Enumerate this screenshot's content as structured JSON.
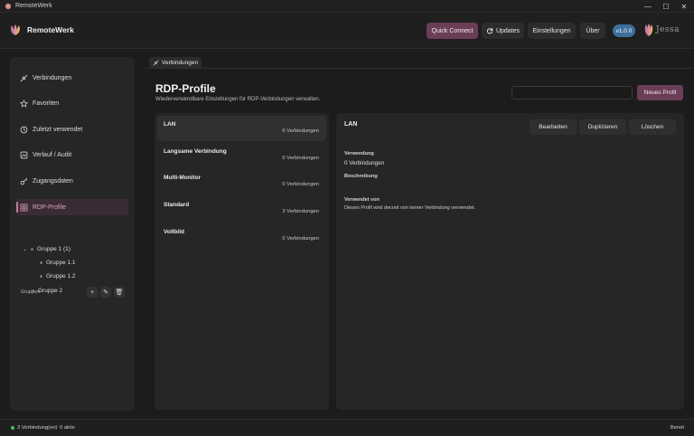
{
  "window": {
    "title": "RemoteWerk",
    "controls": {
      "minimize": "—",
      "maximize": "☐",
      "close": "✕"
    }
  },
  "header": {
    "brand": "RemoteWerk",
    "quick_connect": "Quick Connect",
    "updates": "Updates",
    "settings": "Einstellungen",
    "about": "Über",
    "version": "v1.0.0",
    "partner_logo_text": "Jessa",
    "accent": "#6a3e56"
  },
  "sidebar": {
    "items": [
      {
        "label": "Verbindungen",
        "icon": "plug-icon"
      },
      {
        "label": "Favoriten",
        "icon": "star-icon"
      },
      {
        "label": "Zuletzt verwendet",
        "icon": "history-icon"
      },
      {
        "label": "Verlauf / Audit",
        "icon": "audit-icon"
      },
      {
        "label": "Zugangsdaten",
        "icon": "key-icon"
      },
      {
        "label": "RDP-Profile",
        "icon": "profiles-icon",
        "active": true
      }
    ],
    "groups_label": "Gruppen",
    "group_actions": {
      "add": "+",
      "edit": "✎",
      "delete": "🗑"
    },
    "groups": [
      {
        "label": "Gruppe 1 (1)",
        "expanded": true,
        "children": [
          {
            "label": "Gruppe 1.1"
          },
          {
            "label": "Gruppe 1.2"
          }
        ]
      },
      {
        "label": "Gruppe 2"
      }
    ]
  },
  "tab": {
    "label": "Verbindungen"
  },
  "page": {
    "title": "RDP-Profile",
    "subtitle": "Wiederverwendbare Einstellungen für RDP-Verbindungen verwalten.",
    "search_value": "",
    "new_button": "Neues Profil"
  },
  "profiles": [
    {
      "name": "LAN",
      "count": "0 Verbindungen",
      "selected": true
    },
    {
      "name": "Langsame Verbindung",
      "count": "0 Verbindungen"
    },
    {
      "name": "Multi-Monitor",
      "count": "0 Verbindungen"
    },
    {
      "name": "Standard",
      "count": "3 Verbindungen"
    },
    {
      "name": "Vollbild",
      "count": "0 Verbindungen"
    }
  ],
  "detail": {
    "title": "LAN",
    "edit": "Bearbeiten",
    "duplicate": "Duplizieren",
    "delete": "Löschen",
    "usage_label": "Verwendung",
    "usage_value": "0  Verbindungen",
    "description_label": "Beschreibung",
    "used_by_label": "Verwendet von",
    "used_by_text": "Dieses Profil wird derzeit von keiner Verbindung verwendet."
  },
  "status": {
    "connections": "3 Verbindung(en)",
    "active": "0 aktiv",
    "state": "Bereit"
  }
}
